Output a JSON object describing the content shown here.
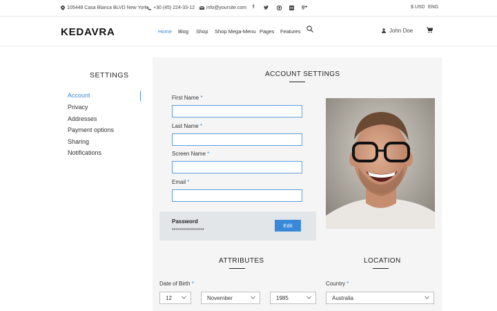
{
  "topbar": {
    "address": "105448 Casa Blanca BLVD New York",
    "phone": "+30 (45) 224-33-12",
    "email": "info@yoursite.com",
    "social_icons": [
      "facebook-icon",
      "twitter-icon",
      "pinterest-icon",
      "flickr-icon",
      "google-plus-icon"
    ],
    "currency": "$ USD",
    "language": "ENG"
  },
  "header": {
    "logo": "KEDAVRA",
    "nav": [
      "Home",
      "Blog",
      "Shop",
      "Shop Mega-Menu",
      "Pages",
      "Features"
    ],
    "active_nav": "Home",
    "user_name": "John Doe"
  },
  "sidebar": {
    "title": "SETTINGS",
    "items": [
      "Account",
      "Privacy",
      "Addresses",
      "Payment options",
      "Sharing",
      "Notifications"
    ],
    "active_item": "Account"
  },
  "account": {
    "title": "ACCOUNT SETTINGS",
    "fields": [
      {
        "label": "First Name",
        "required": "*",
        "value": ""
      },
      {
        "label": "Last Name",
        "required": "*",
        "value": ""
      },
      {
        "label": "Screen Name",
        "required": "*",
        "value": ""
      },
      {
        "label": "Email",
        "required": "*",
        "value": ""
      }
    ],
    "password": {
      "label": "Password",
      "value": "****************",
      "edit_label": "Edit"
    }
  },
  "attributes": {
    "title": "ATTRIBUTES",
    "dob_label": "Date of Birth",
    "required": "*",
    "day": "12",
    "month": "November",
    "year": "1985"
  },
  "location": {
    "title": "LOCATION",
    "country_label": "Country",
    "required": "*",
    "country": "Australia"
  },
  "colors": {
    "accent": "#3a89d9",
    "panel": "#f5f5f5",
    "password_box": "#e3e6e9"
  }
}
